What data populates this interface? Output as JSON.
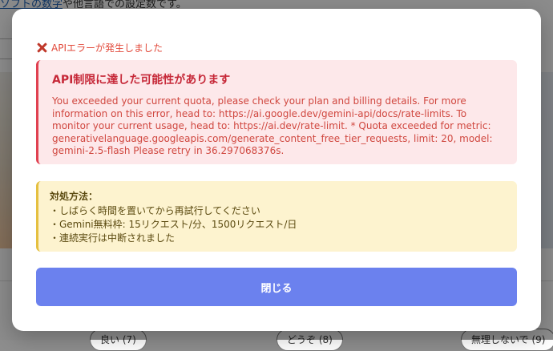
{
  "background": {
    "top_text_link": "ソフトの数字",
    "top_text_rest": "や他言語での設定数です。",
    "chips": [
      "良い (7)",
      "どうぞ (8)",
      "無理しないで (9)"
    ]
  },
  "modal": {
    "header": {
      "icon": "close-icon",
      "text": "APIエラーが発生しました"
    },
    "error": {
      "title": "API制限に達した可能性があります",
      "message": "You exceeded your current quota, please check your plan and billing details. For more information on this error, head to: https://ai.google.dev/gemini-api/docs/rate-limits. To monitor your current usage, head to: https://ai.dev/rate-limit. * Quota exceeded for metric: generativelanguage.googleapis.com/generate_content_free_tier_requests, limit: 20, model: gemini-2.5-flash Please retry in 36.297068376s."
    },
    "solution": {
      "title": "対処方法：",
      "items": [
        "・しばらく時間を置いてから再試行してください",
        "・Gemini無料枠: 15リクエスト/分、1500リクエスト/日",
        "・連続実行は中断されました"
      ]
    },
    "close_button_label": "閉じる"
  },
  "colors": {
    "error_accent": "#e04050",
    "warning_accent": "#e5c040",
    "primary_button": "#6b81ee"
  }
}
